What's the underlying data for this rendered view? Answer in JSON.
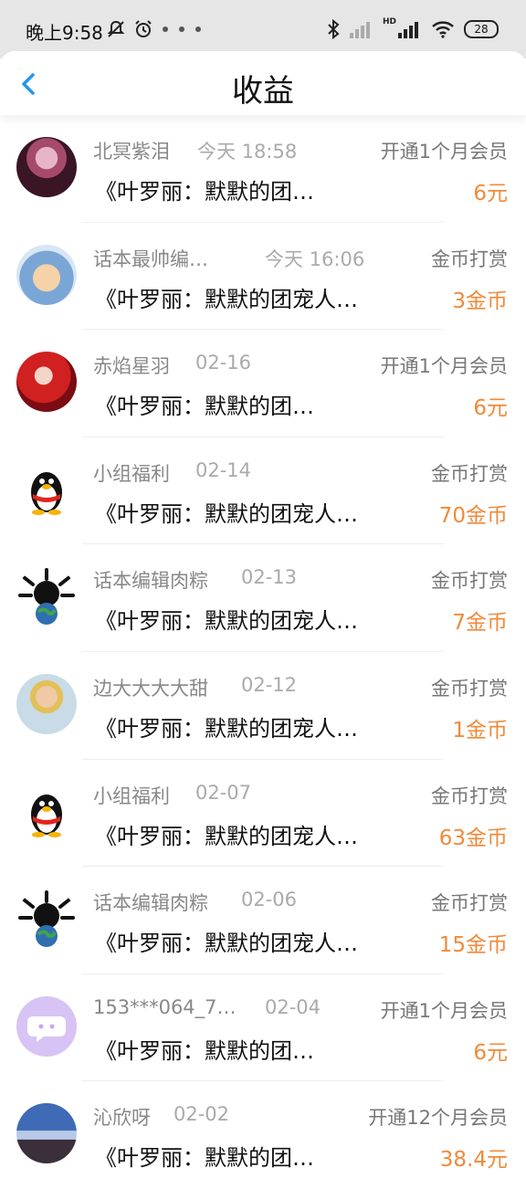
{
  "status_bar": {
    "time": "晚上9:58",
    "battery": "28",
    "network_label": "HD"
  },
  "header": {
    "title": "收益",
    "back_icon": "chevron-left-icon"
  },
  "colors": {
    "accent": "#2196f3",
    "amount": "#f08a3a"
  },
  "earnings": [
    {
      "user": "北冥紫泪",
      "date": "今天 18:58",
      "type": "开通1个月会员",
      "book": "《叶罗丽：默默的团…",
      "amount": "6元"
    },
    {
      "user": "话本最帅编…",
      "date": "今天 16:06",
      "type": "金币打赏",
      "book": "《叶罗丽：默默的团宠人…",
      "amount": "3金币"
    },
    {
      "user": "赤焰星羽",
      "date": "02-16",
      "type": "开通1个月会员",
      "book": "《叶罗丽：默默的团…",
      "amount": "6元"
    },
    {
      "user": "小组福利",
      "date": "02-14",
      "type": "金币打赏",
      "book": "《叶罗丽：默默的团宠人…",
      "amount": "70金币"
    },
    {
      "user": "话本编辑肉粽",
      "date": "02-13",
      "type": "金币打赏",
      "book": "《叶罗丽：默默的团宠人…",
      "amount": "7金币"
    },
    {
      "user": "边大大大大甜",
      "date": "02-12",
      "type": "金币打赏",
      "book": "《叶罗丽：默默的团宠人…",
      "amount": "1金币"
    },
    {
      "user": "小组福利",
      "date": "02-07",
      "type": "金币打赏",
      "book": "《叶罗丽：默默的团宠人…",
      "amount": "63金币"
    },
    {
      "user": "话本编辑肉粽",
      "date": "02-06",
      "type": "金币打赏",
      "book": "《叶罗丽：默默的团宠人…",
      "amount": "15金币"
    },
    {
      "user": "153***064_7…",
      "date": "02-04",
      "type": "开通1个月会员",
      "book": "《叶罗丽：默默的团…",
      "amount": "6元"
    },
    {
      "user": "沁欣呀",
      "date": "02-02",
      "type": "开通12个月会员",
      "book": "《叶罗丽：默默的团…",
      "amount": "38.4元"
    }
  ]
}
